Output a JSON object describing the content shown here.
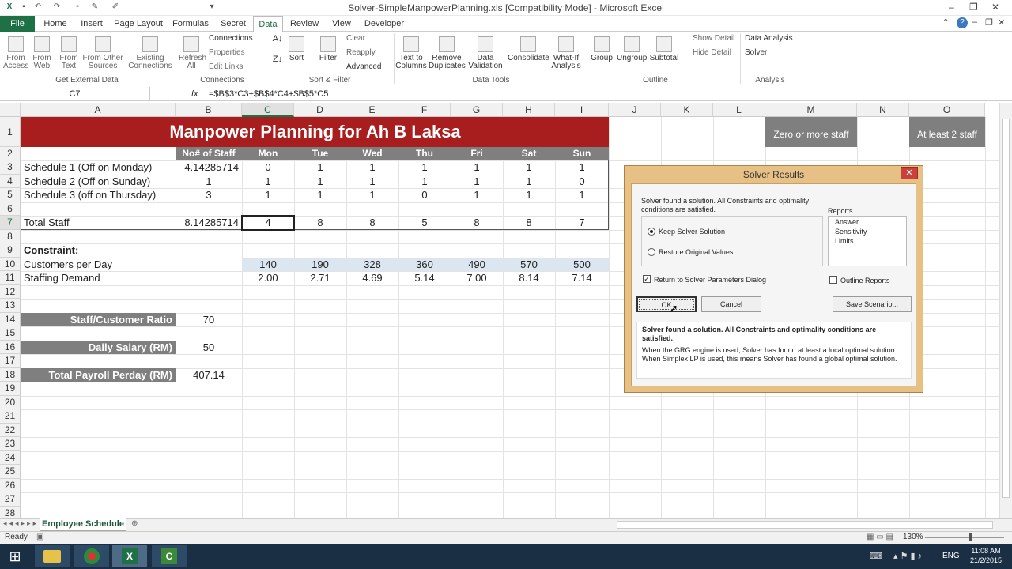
{
  "app": {
    "title": "Solver-SimpleManpowerPlanning.xls  [Compatibility Mode]  -  Microsoft Excel"
  },
  "tabs": [
    "File",
    "Home",
    "Insert",
    "Page Layout",
    "Formulas",
    "Secret",
    "Data",
    "Review",
    "View",
    "Developer"
  ],
  "ribbon": {
    "get_external": {
      "from_access": "From Access",
      "from_web": "From Web",
      "from_text": "From Text",
      "from_other": "From Other Sources",
      "existing": "Existing Connections",
      "label": "Get External Data"
    },
    "connections": {
      "refresh": "Refresh All",
      "connections": "Connections",
      "properties": "Properties",
      "edit_links": "Edit Links",
      "label": "Connections"
    },
    "sort": {
      "sort": "Sort",
      "filter": "Filter",
      "clear": "Clear",
      "reapply": "Reapply",
      "advanced": "Advanced",
      "label": "Sort & Filter"
    },
    "tools": {
      "text_to_columns": "Text to Columns",
      "remove_duplicates": "Remove Duplicates",
      "data_validation": "Data Validation",
      "consolidate": "Consolidate",
      "what_if": "What-If Analysis",
      "label": "Data Tools"
    },
    "outline": {
      "group": "Group",
      "ungroup": "Ungroup",
      "subtotal": "Subtotal",
      "show_detail": "Show Detail",
      "hide_detail": "Hide Detail",
      "label": "Outline"
    },
    "analysis": {
      "data_analysis": "Data Analysis",
      "solver": "Solver",
      "label": "Analysis"
    }
  },
  "formula_bar": {
    "namebox": "C7",
    "fx": "fx",
    "formula": "=$B$3*C3+$B$4*C4+$B$5*C5"
  },
  "columns": [
    "A",
    "B",
    "C",
    "D",
    "E",
    "F",
    "G",
    "H",
    "I",
    "J",
    "K",
    "L",
    "M",
    "N",
    "O"
  ],
  "rows": [
    "1",
    "2",
    "3",
    "4",
    "5",
    "6",
    "7",
    "8",
    "9",
    "10",
    "11",
    "12",
    "13",
    "14",
    "15",
    "16",
    "17",
    "18",
    "19",
    "20",
    "21",
    "22",
    "23",
    "24",
    "25",
    "26",
    "27",
    "28"
  ],
  "sheet": {
    "banner": "Manpower Planning for Ah B Laksa",
    "header": [
      "No# of Staff",
      "Mon",
      "Tue",
      "Wed",
      "Thu",
      "Fri",
      "Sat",
      "Sun"
    ],
    "schedules": [
      {
        "label": "Schedule 1 (Off on Monday)",
        "staff": "4.14285714",
        "days": [
          "0",
          "1",
          "1",
          "1",
          "1",
          "1",
          "1"
        ]
      },
      {
        "label": "Schedule 2 (Off on Sunday)",
        "staff": "1",
        "days": [
          "1",
          "1",
          "1",
          "1",
          "1",
          "1",
          "0"
        ]
      },
      {
        "label": "Schedule 3 (off on Thursday)",
        "staff": "3",
        "days": [
          "1",
          "1",
          "1",
          "0",
          "1",
          "1",
          "1"
        ]
      }
    ],
    "total": {
      "label": "Total Staff",
      "staff": "8.14285714",
      "days": [
        "4",
        "8",
        "8",
        "5",
        "8",
        "8",
        "7"
      ]
    },
    "constraint": "Constraint:",
    "customers": {
      "label": "Customers per Day",
      "values": [
        "140",
        "190",
        "328",
        "360",
        "490",
        "570",
        "500"
      ]
    },
    "demand": {
      "label": "Staffing Demand",
      "values": [
        "2.00",
        "2.71",
        "4.69",
        "5.14",
        "7.00",
        "8.14",
        "7.14"
      ]
    },
    "ratio": {
      "label": "Staff/Customer Ratio",
      "value": "70"
    },
    "salary": {
      "label": "Daily Salary (RM)",
      "value": "50"
    },
    "payroll": {
      "label": "Total Payroll Perday (RM)",
      "value": "407.14"
    },
    "note_m": "Zero or more staff",
    "note_o": "At least 2 staff"
  },
  "sheet_tab": "Employee Schedule",
  "status": {
    "ready": "Ready",
    "zoom": "130%"
  },
  "taskbar": {
    "lang": "ENG",
    "time": "11:08 AM",
    "date": "21/2/2015"
  },
  "dialog": {
    "title": "Solver Results",
    "message": "Solver found a solution.  All Constraints and optimality conditions are satisfied.",
    "reports_label": "Reports",
    "reports": [
      "Answer",
      "Sensitivity",
      "Limits"
    ],
    "keep": "Keep Solver Solution",
    "restore": "Restore Original Values",
    "return": "Return to Solver Parameters Dialog",
    "outline": "Outline Reports",
    "ok": "OK",
    "cancel": "Cancel",
    "save": "Save Scenario...",
    "info_bold": "Solver found a solution.  All Constraints and optimality conditions are satisfied.",
    "info": "When the GRG engine is used, Solver has found at least a local optimal solution. When Simplex LP is used, this means Solver has found a global optimal solution."
  }
}
